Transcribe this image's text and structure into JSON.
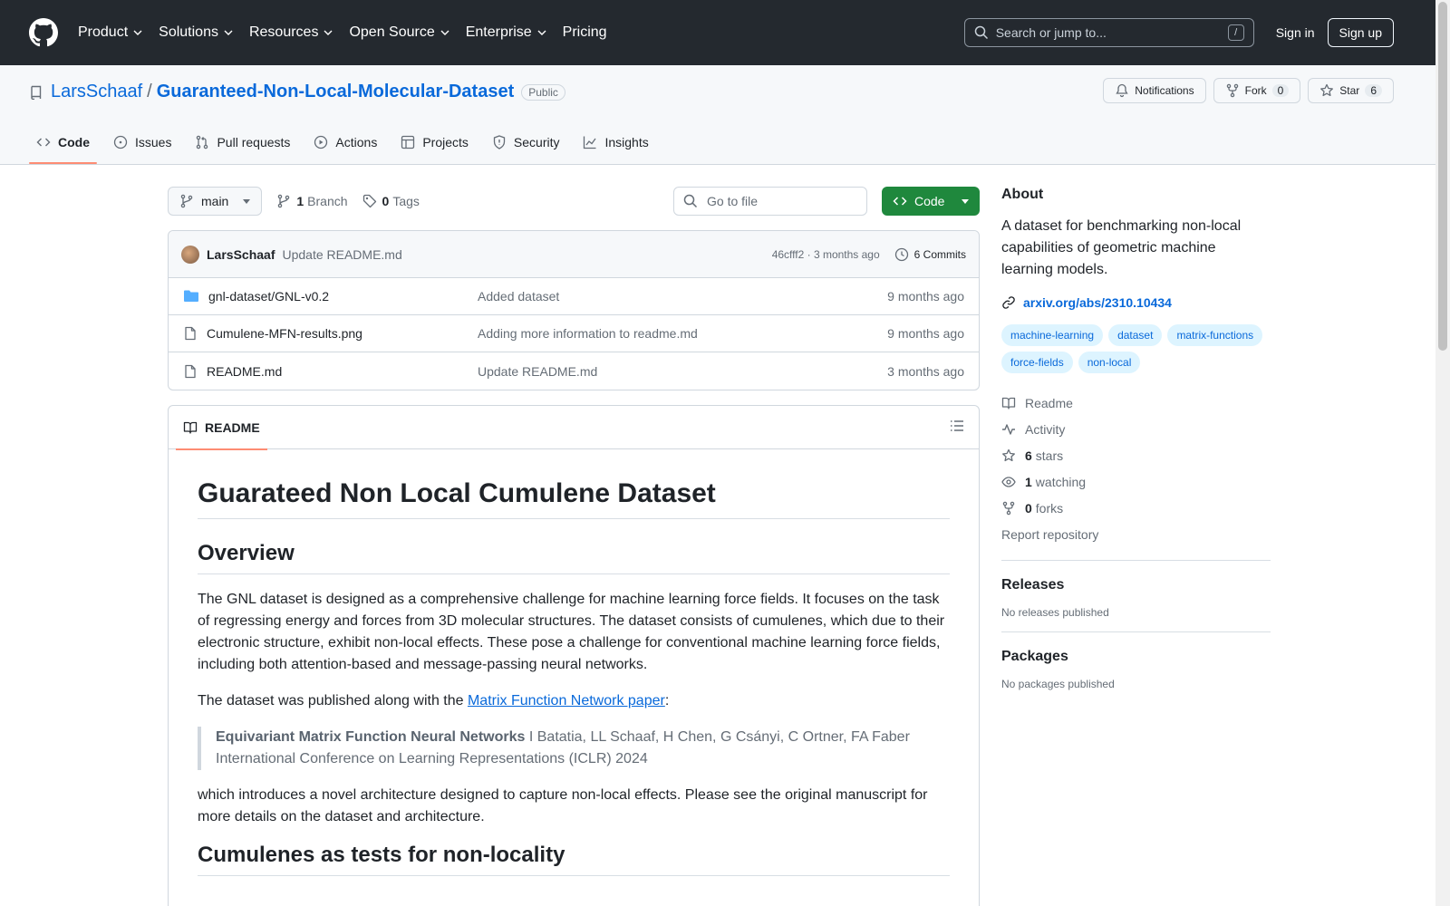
{
  "header": {
    "nav": [
      "Product",
      "Solutions",
      "Resources",
      "Open Source",
      "Enterprise"
    ],
    "pricing": "Pricing",
    "search_placeholder": "Search or jump to...",
    "search_shortcut": "/",
    "sign_in": "Sign in",
    "sign_up": "Sign up"
  },
  "repo": {
    "owner": "LarsSchaaf",
    "separator": "/",
    "name": "Guaranteed-Non-Local-Molecular-Dataset",
    "visibility": "Public",
    "notifications": "Notifications",
    "fork_label": "Fork",
    "fork_count": "0",
    "star_label": "Star",
    "star_count": "6"
  },
  "tabs": [
    "Code",
    "Issues",
    "Pull requests",
    "Actions",
    "Projects",
    "Security",
    "Insights"
  ],
  "toolbar": {
    "branch": "main",
    "branch_count": "1",
    "branch_label": "Branch",
    "tag_count": "0",
    "tag_label": "Tags",
    "goto_placeholder": "Go to file",
    "code_button": "Code"
  },
  "commit": {
    "author": "LarsSchaaf",
    "message": "Update README.md",
    "meta": "46cfff2 · 3 months ago",
    "commits": "6 Commits"
  },
  "files": [
    {
      "name": "gnl-dataset/GNL-v0.2",
      "type": "folder",
      "message": "Added dataset",
      "date": "9 months ago"
    },
    {
      "name": "Cumulene-MFN-results.png",
      "type": "file",
      "message": "Adding more information to readme.md",
      "date": "9 months ago"
    },
    {
      "name": "README.md",
      "type": "file",
      "message": "Update README.md",
      "date": "3 months ago"
    }
  ],
  "readme": {
    "tab": "README",
    "h1": "Guarateed Non Local Cumulene Dataset",
    "h2_overview": "Overview",
    "p1": "The GNL dataset is designed as a comprehensive challenge for machine learning force fields. It focuses on the task of regressing energy and forces from 3D molecular structures. The dataset consists of cumulenes, which due to their electronic structure, exhibit non-local effects. These pose a challenge for conventional machine learning force fields, including both attention-based and message-passing neural networks.",
    "p2_prefix": "The dataset was published along with the ",
    "p2_link": "Matrix Function Network paper",
    "p2_suffix": ":",
    "quote_title": "Equivariant Matrix Function Neural Networks",
    "quote_authors": " I Batatia, LL Schaaf, H Chen, G Csányi, C Ortner, FA Faber",
    "quote_venue": "International Conference on Learning Representations (ICLR) 2024",
    "p3": "which introduces a novel architecture designed to capture non-local effects. Please see the original manuscript for more details on the dataset and architecture.",
    "h2_cumulenes": "Cumulenes as tests for non-locality"
  },
  "about": {
    "title": "About",
    "description": "A dataset for benchmarking non-local capabilities of geometric machine learning models.",
    "link": "arxiv.org/abs/2310.10434",
    "topics": [
      "machine-learning",
      "dataset",
      "matrix-functions",
      "force-fields",
      "non-local"
    ],
    "readme": "Readme",
    "activity": "Activity",
    "stars_count": "6",
    "stars_label": "stars",
    "watching_count": "1",
    "watching_label": "watching",
    "forks_count": "0",
    "forks_label": "forks",
    "report": "Report repository"
  },
  "releases": {
    "title": "Releases",
    "empty": "No releases published"
  },
  "packages": {
    "title": "Packages",
    "empty": "No packages published"
  }
}
